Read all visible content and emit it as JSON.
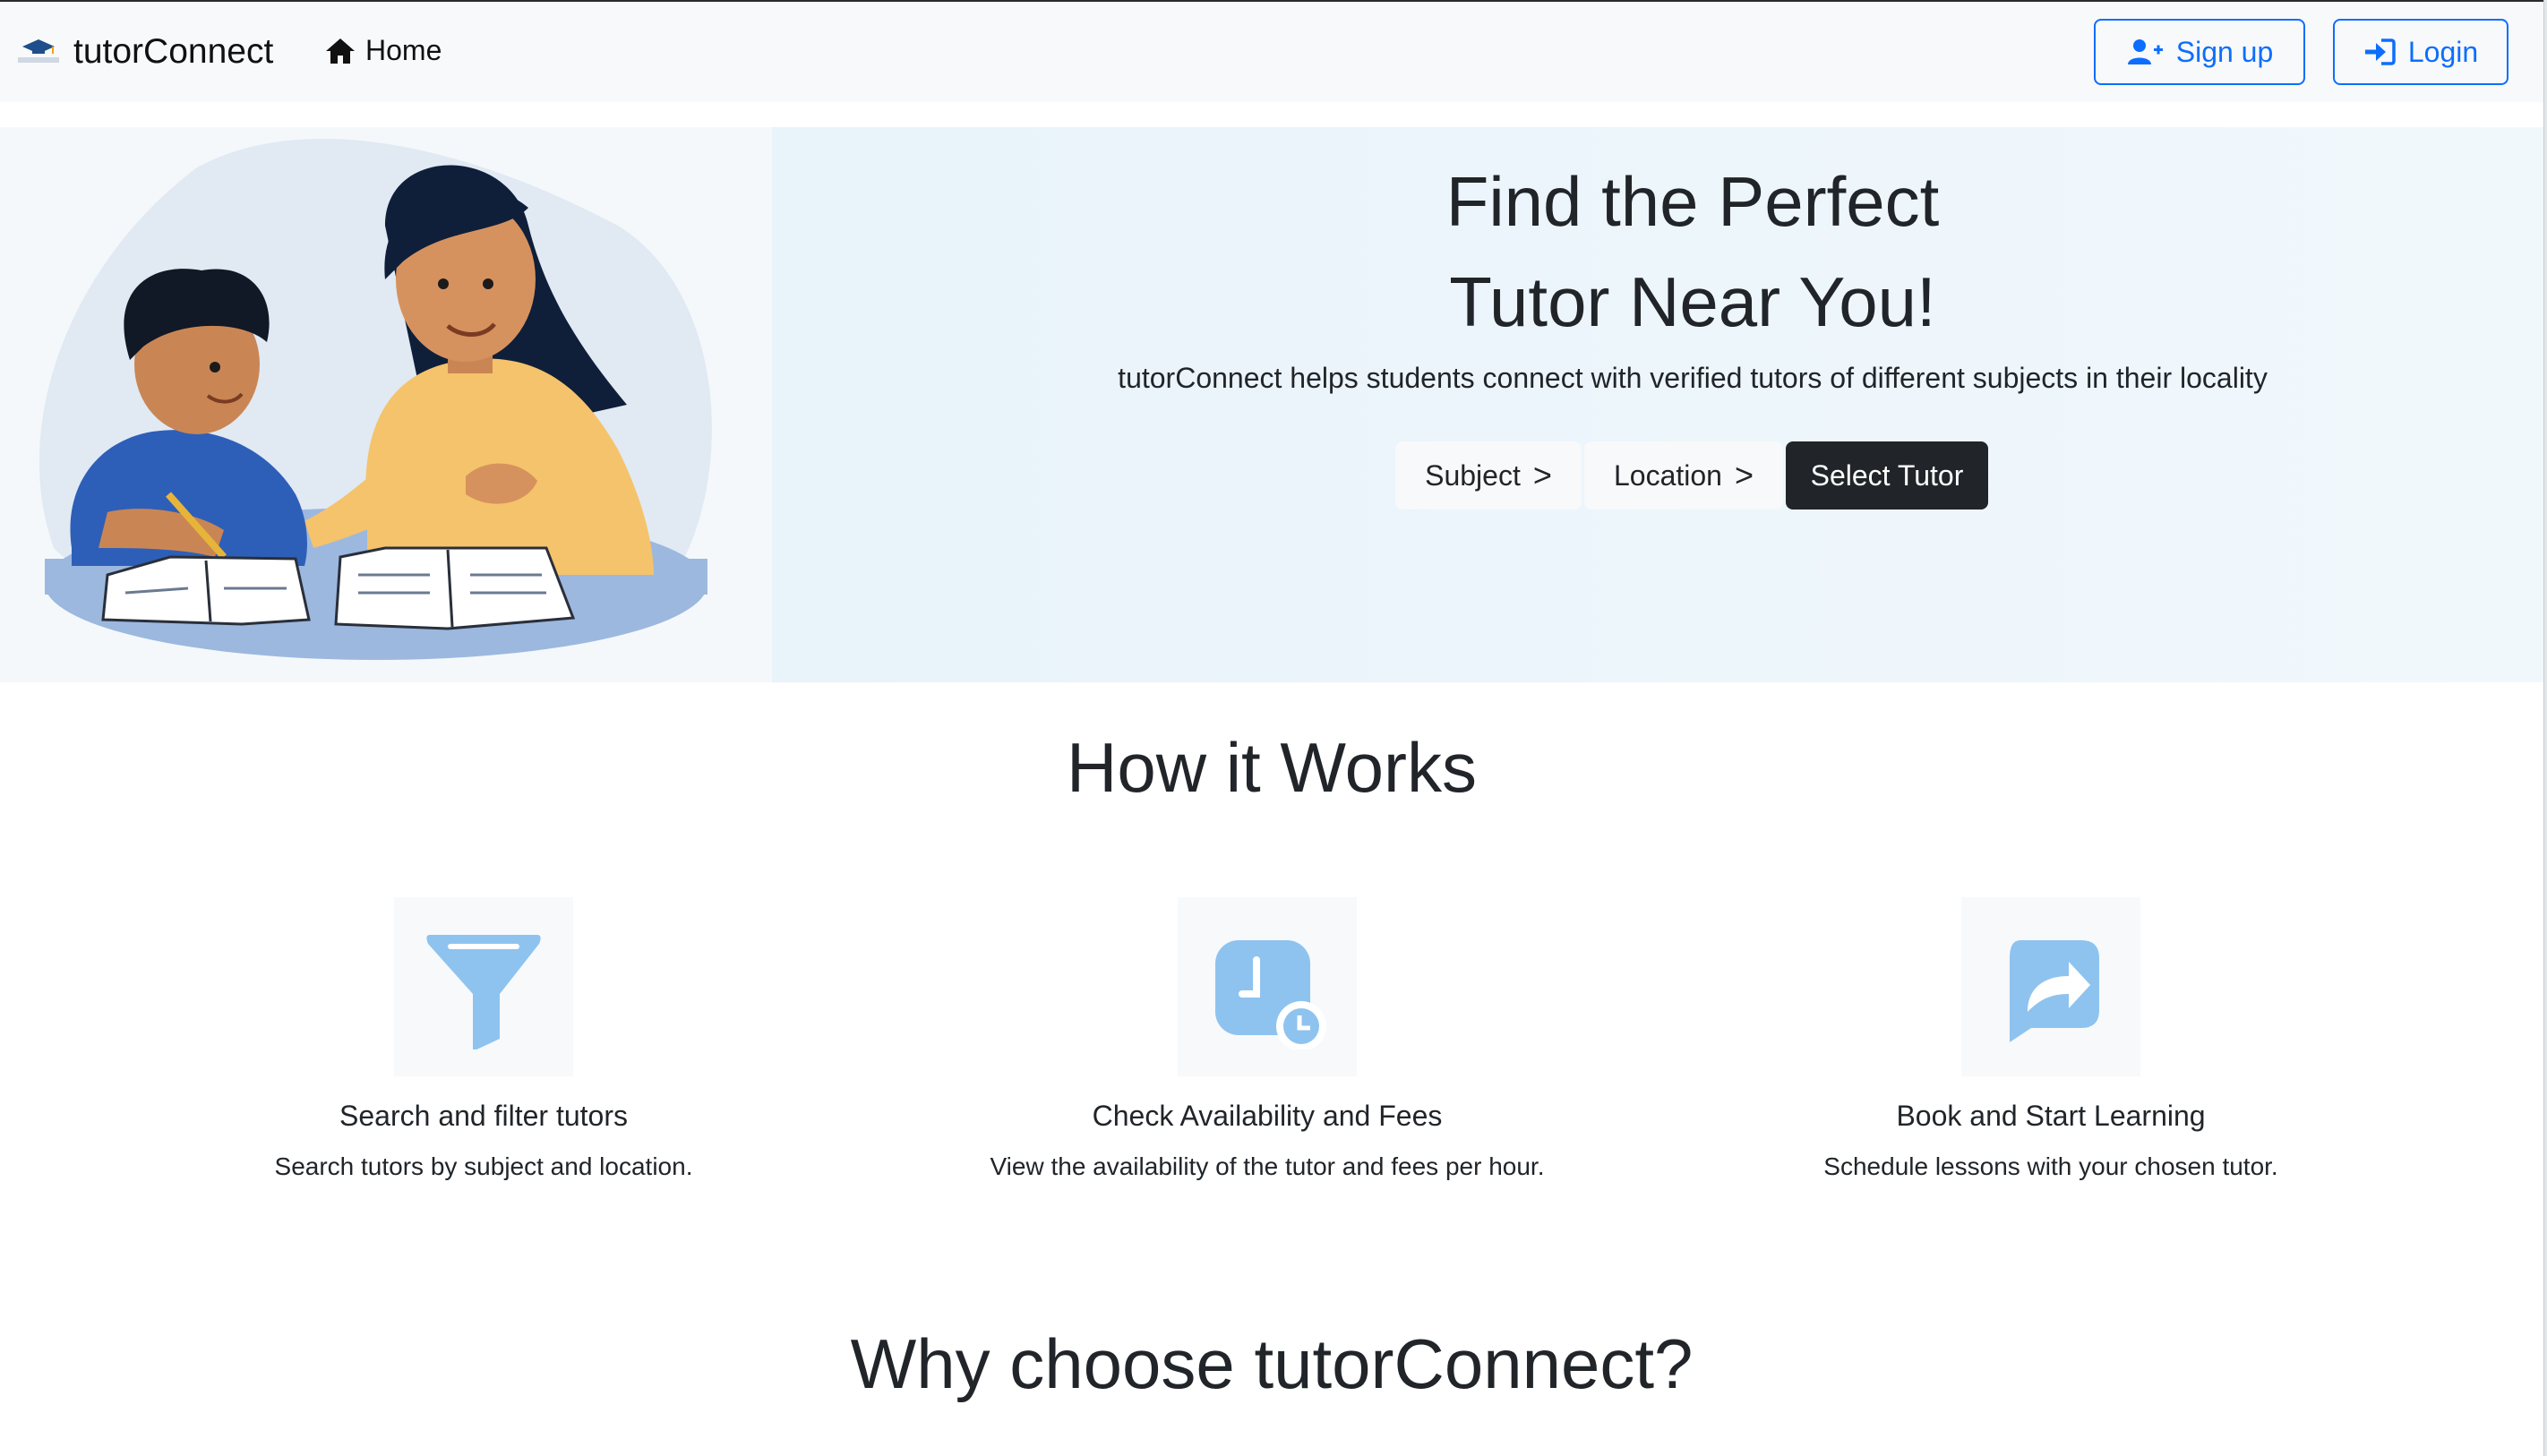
{
  "navbar": {
    "brand": "tutorConnect",
    "home_label": "Home",
    "signup_label": "Sign up",
    "login_label": "Login"
  },
  "hero": {
    "title_line1": "Find the Perfect",
    "title_line2": "Tutor Near You!",
    "subtitle": "tutorConnect helps students connect with verified tutors of different subjects in their locality",
    "subject_label": "Subject",
    "location_label": "Location",
    "select_label": "Select Tutor"
  },
  "how": {
    "title": "How it Works",
    "steps": [
      {
        "icon": "funnel-icon",
        "title": "Search and filter tutors",
        "desc": "Search tutors by subject and location."
      },
      {
        "icon": "calendar-clock-icon",
        "title": "Check Availability and Fees",
        "desc": "View the availability of the tutor and fees per hour."
      },
      {
        "icon": "share-arrow-icon",
        "title": "Book and Start Learning",
        "desc": "Schedule lessons with your chosen tutor."
      }
    ]
  },
  "why": {
    "title": "Why choose tutorConnect?"
  },
  "colors": {
    "primary": "#0d6efd",
    "dark": "#212529",
    "icon_blue": "#8ec3ef",
    "hero_bg": "#eef6fb"
  }
}
